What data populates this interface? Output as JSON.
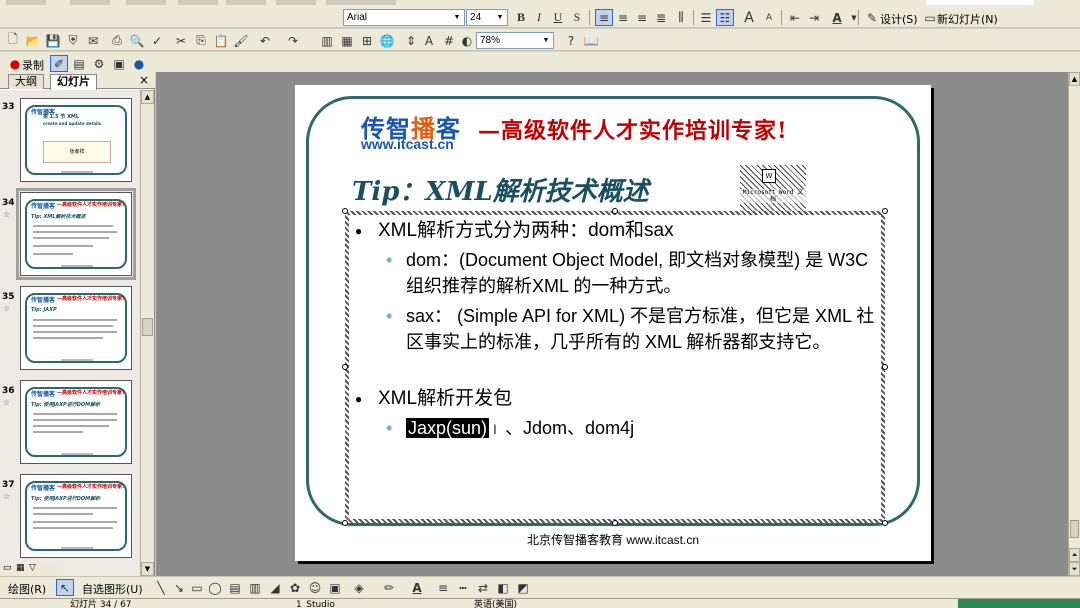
{
  "toolbar_format": {
    "font_name": "Arial",
    "font_size": "24",
    "bold": "B",
    "italic": "I",
    "underline": "U",
    "shadow": "S",
    "design_label": "设计(S)",
    "new_slide_label": "新幻灯片(N)"
  },
  "toolbar_standard": {
    "zoom": "78%"
  },
  "toolbar_record": {
    "record_label": "录制"
  },
  "left_pane": {
    "tabs": [
      "大纲",
      "幻灯片"
    ],
    "close": "×",
    "thumbnails": [
      {
        "number": "33",
        "title": "第 1.5 节 XML",
        "subtitle": "create and update details",
        "box_text": "张孝祥"
      },
      {
        "number": "34",
        "title": "Tip: XML解析技术概述",
        "selected": true
      },
      {
        "number": "35",
        "title": "Tip: JAXP"
      },
      {
        "number": "36",
        "title": "Tip: 使用JAXP进行DOM解析"
      },
      {
        "number": "37",
        "title": "Tip: 使用JAXP进行DOM解析"
      }
    ]
  },
  "slide": {
    "logo_cn": "传智播客",
    "logo_highlight": "播",
    "logo_url": "www.itcast.cn",
    "slogan": "—高级软件人才实作培训专家!",
    "title": "Tip：XML解析技术概述",
    "embedded_label": "Microsoft Word 文档",
    "bullets": {
      "b1": "XML解析方式分为两种：dom和sax",
      "b1_sub1": "dom：(Document Object Model, 即文档对象模型) 是 W3C 组织推荐的解析XML 的一种方式。",
      "b1_sub2": "sax： (Simple API for XML) 不是官方标准，但它是 XML 社区事实上的标准，几乎所有的 XML 解析器都支持它。",
      "b2": "XML解析开发包",
      "b2_sub1_selected": "Jaxp(sun)",
      "b2_sub1_rest": "、Jdom、dom4j"
    },
    "footer": "北京传智播客教育 www.itcast.cn"
  },
  "drawbar": {
    "draw_label": "绘图(R)",
    "autoshape_label": "自选图形(U)"
  },
  "statusbar": {
    "slide_pos": "幻灯片 34 / 67",
    "design": "1_Studio",
    "language": "英语(美国)"
  },
  "colors": {
    "frame": "#2f6a6a",
    "logo_blue": "#1a57a8",
    "slogan_red": "#c00000",
    "title_teal": "#1a4f60",
    "sub_bullet": "#6bb7c4"
  }
}
